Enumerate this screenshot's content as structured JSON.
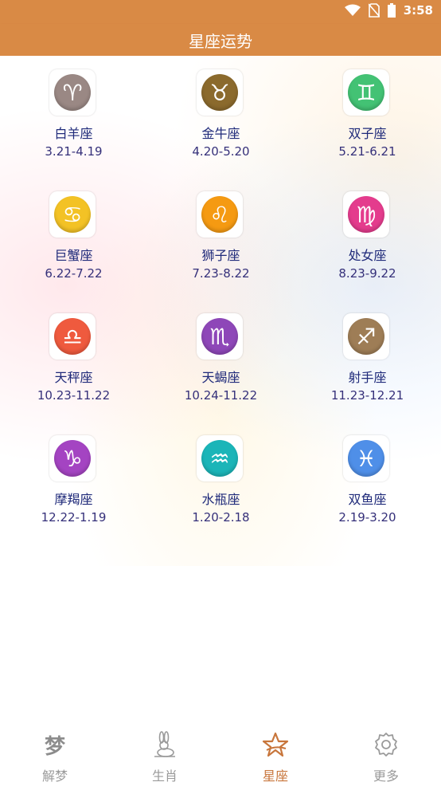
{
  "status": {
    "time": "3:58"
  },
  "header": {
    "title": "星座运势"
  },
  "signs": [
    {
      "name": "白羊座",
      "date": "3.21-4.19",
      "symbol": "♈",
      "color": "#9a8884",
      "icon": "aries-icon"
    },
    {
      "name": "金牛座",
      "date": "4.20-5.20",
      "symbol": "♉",
      "color": "#8b6a2d",
      "icon": "taurus-icon"
    },
    {
      "name": "双子座",
      "date": "5.21-6.21",
      "symbol": "♊",
      "color": "#43c274",
      "icon": "gemini-icon"
    },
    {
      "name": "巨蟹座",
      "date": "6.22-7.22",
      "symbol": "♋",
      "color": "#f3c225",
      "icon": "cancer-icon"
    },
    {
      "name": "狮子座",
      "date": "7.23-8.22",
      "symbol": "♌",
      "color": "#f59a12",
      "icon": "leo-icon"
    },
    {
      "name": "处女座",
      "date": "8.23-9.22",
      "symbol": "♍",
      "color": "#e43c8d",
      "icon": "virgo-icon"
    },
    {
      "name": "天秤座",
      "date": "10.23-11.22",
      "symbol": "♎",
      "color": "#ef5a3e",
      "icon": "libra-icon"
    },
    {
      "name": "天蝎座",
      "date": "10.24-11.22",
      "symbol": "♏",
      "color": "#8e47b8",
      "icon": "scorpio-icon"
    },
    {
      "name": "射手座",
      "date": "11.23-12.21",
      "symbol": "♐",
      "color": "#9e7d56",
      "icon": "sagittarius-icon"
    },
    {
      "name": "摩羯座",
      "date": "12.22-1.19",
      "symbol": "♑",
      "color": "#a444c2",
      "icon": "capricorn-icon"
    },
    {
      "name": "水瓶座",
      "date": "1.20-2.18",
      "symbol": "♒",
      "color": "#1bb5b8",
      "icon": "aquarius-icon"
    },
    {
      "name": "双鱼座",
      "date": "2.19-3.20",
      "symbol": "♓",
      "color": "#4f8fe8",
      "icon": "pisces-icon"
    }
  ],
  "tabs": [
    {
      "label": "解梦",
      "icon": "dream-icon",
      "active": false
    },
    {
      "label": "生肖",
      "icon": "rabbit-icon",
      "active": false
    },
    {
      "label": "星座",
      "icon": "star-icon",
      "active": true
    },
    {
      "label": "更多",
      "icon": "gear-icon",
      "active": false
    }
  ],
  "tab_icon_glyph": {
    "dream": "梦"
  },
  "colors": {
    "accent": "#d98a45",
    "active_tab": "#c8763c"
  }
}
